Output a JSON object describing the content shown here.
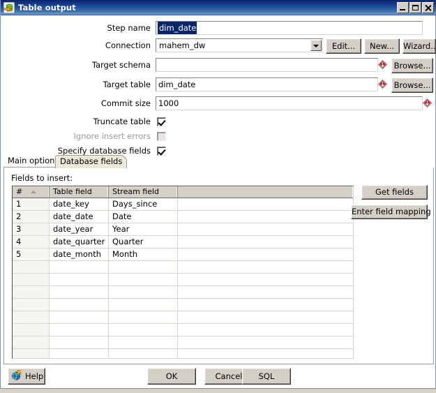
{
  "window": {
    "title": "Table output",
    "icon": "table-output-icon",
    "controls": {
      "minimize": "minimize-button",
      "maximize": "maximize-button",
      "close": "close-button"
    }
  },
  "form": {
    "step_name": {
      "label": "Step name",
      "value": "dim_date",
      "selected": true
    },
    "connection": {
      "label": "Connection",
      "value": "mahem_dw",
      "edit_label": "Edit...",
      "new_label": "New...",
      "wizard_label": "Wizard..."
    },
    "target_schema": {
      "label": "Target schema",
      "value": "",
      "placeholder": "",
      "browse_label": "Browse..."
    },
    "target_table": {
      "label": "Target table",
      "value": "dim_date",
      "placeholder": "",
      "browse_label": "Browse..."
    },
    "commit_size": {
      "label": "Commit size",
      "value": "1000",
      "placeholder": ""
    },
    "truncate_table": {
      "label": "Truncate table",
      "checked": true,
      "enabled": true
    },
    "ignore_insert_errors": {
      "label": "Ignore insert errors",
      "checked": false,
      "enabled": false
    },
    "specify_database_fields": {
      "label": "Specify database fields",
      "checked": true,
      "enabled": true
    }
  },
  "tabs": {
    "items": [
      {
        "label": "Main options",
        "active": false
      },
      {
        "label": "Database fields",
        "active": true
      }
    ]
  },
  "fields_panel": {
    "heading": "Fields to insert:",
    "get_fields_label": "Get fields",
    "enter_field_mapping_label": "Enter field mapping",
    "grid": {
      "columns": [
        "#",
        "Table field",
        "Stream field",
        ""
      ],
      "sort_column": "#",
      "sort_direction": "ascending",
      "rows": [
        {
          "num": "1",
          "table_field": "date_key",
          "stream_field": "Days_since",
          "extra": ""
        },
        {
          "num": "2",
          "table_field": "date_date",
          "stream_field": "Date",
          "extra": ""
        },
        {
          "num": "3",
          "table_field": "date_year",
          "stream_field": "Year",
          "extra": ""
        },
        {
          "num": "4",
          "table_field": "date_quarter",
          "stream_field": "Quarter",
          "extra": ""
        },
        {
          "num": "5",
          "table_field": "date_month",
          "stream_field": "Month",
          "extra": ""
        }
      ],
      "empty_row_count": 8
    }
  },
  "footer": {
    "help_label": "Help",
    "ok_label": "OK",
    "cancel_label": "Cancel",
    "sql_label": "SQL"
  },
  "colors": {
    "titlebar_start": "#0a246a",
    "titlebar_end": "#6f9ed6",
    "selection": "#0a246a",
    "button_face": "#d4d0c8",
    "tab_active": "#ece9d8",
    "variable_marker": "#cc1122",
    "disabled_text": "#9a9a96"
  }
}
